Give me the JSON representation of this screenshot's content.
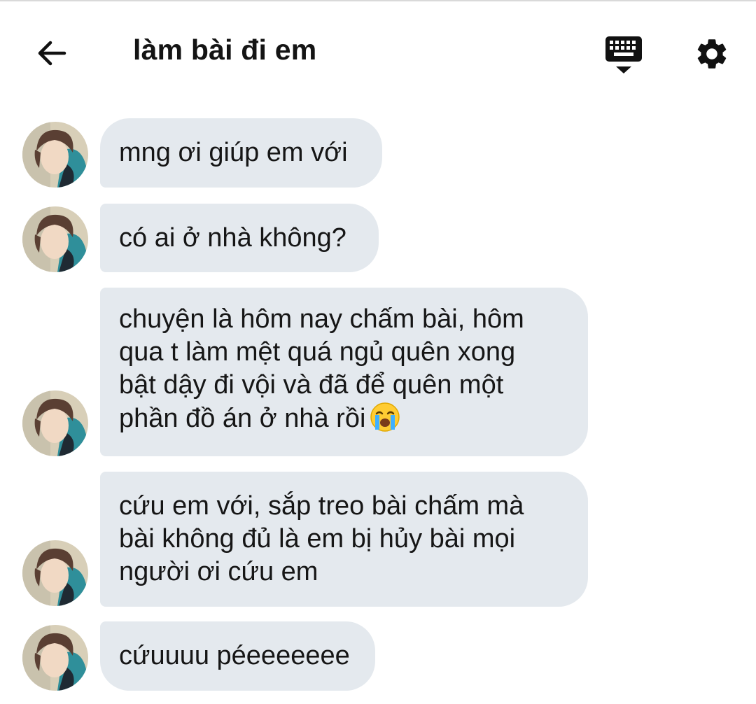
{
  "header": {
    "title": "làm bài đi em",
    "back_icon": "arrow-left-icon",
    "keyboard_icon": "keyboard-hide-icon",
    "settings_icon": "gear-icon"
  },
  "colors": {
    "bubble_background": "#e4e9ee",
    "text": "#161616",
    "icon": "#111111"
  },
  "messages": [
    {
      "text": "mng ơi giúp em với"
    },
    {
      "text": "có ai ở nhà không?"
    },
    {
      "text": "chuyện là hôm nay chấm bài, hôm\nqua t làm mệt quá ngủ quên xong\nbật dậy đi vội và đã để quên một\nphần đồ án ở nhà rồi",
      "emoji": "loudly-crying-face-icon"
    },
    {
      "text": "cứu em với, sắp treo bài chấm mà\nbài không đủ là em bị hủy bài mọi\nngười ơi cứu em"
    },
    {
      "text": "cứuuuu péeeeeeee"
    }
  ]
}
